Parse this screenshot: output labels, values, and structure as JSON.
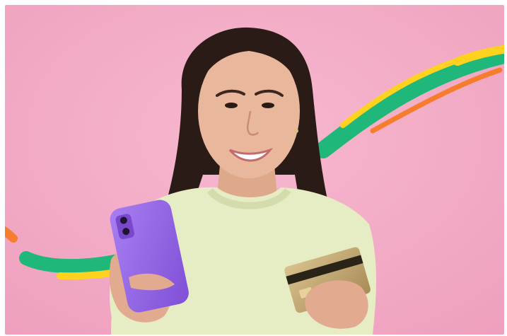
{
  "image": {
    "subject": "woman-holding-phone-and-card",
    "colors": {
      "background": "#f3a9c4",
      "swoosh_green": "#1fb87a",
      "swoosh_yellow": "#ffd21f",
      "swoosh_orange": "#f57d2d",
      "phone": "#9b6ee8",
      "sweater": "#e6ecc3",
      "hair": "#2a1b17",
      "skin": "#e9b89c",
      "card": "#c9b07a"
    }
  }
}
